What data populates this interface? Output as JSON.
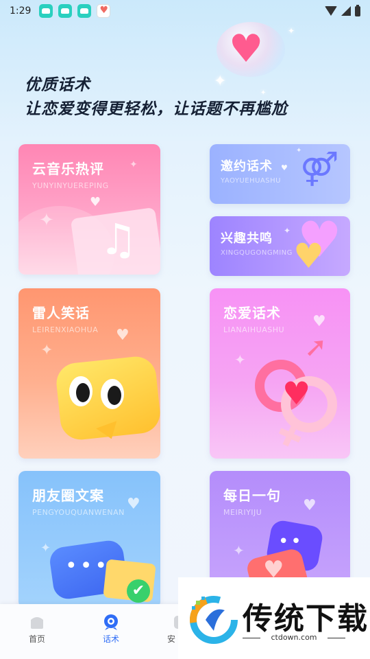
{
  "status_bar": {
    "time": "1:29"
  },
  "header": {
    "line1": "优质话术",
    "line2": "让恋爱变得更轻松，让话题不再尴尬"
  },
  "cards": [
    {
      "title": "云音乐热评",
      "subtitle": "YUNYINYUEREPING"
    },
    {
      "title": "邀约话术",
      "subtitle": "YAOYUEHUASHU"
    },
    {
      "title": "兴趣共鸣",
      "subtitle": "XINGQUGONGMING"
    },
    {
      "title": "雷人笑话",
      "subtitle": "LEIRENXIAOHUA"
    },
    {
      "title": "恋爱话术",
      "subtitle": "LIANAIHUASHU"
    },
    {
      "title": "朋友圈文案",
      "subtitle": "PENGYOUQUANWENAN"
    },
    {
      "title": "每日一句",
      "subtitle": "MEIRIYIJU"
    }
  ],
  "bottom_nav": {
    "items": [
      {
        "label": "首页",
        "icon": "home-icon"
      },
      {
        "label": "话术",
        "icon": "chat-icon",
        "active": true
      },
      {
        "label": "安",
        "icon": "safety-icon"
      }
    ],
    "active_color": "#2f6df6"
  },
  "watermark": {
    "brand": "传统下载",
    "url": "ctdown.com"
  }
}
